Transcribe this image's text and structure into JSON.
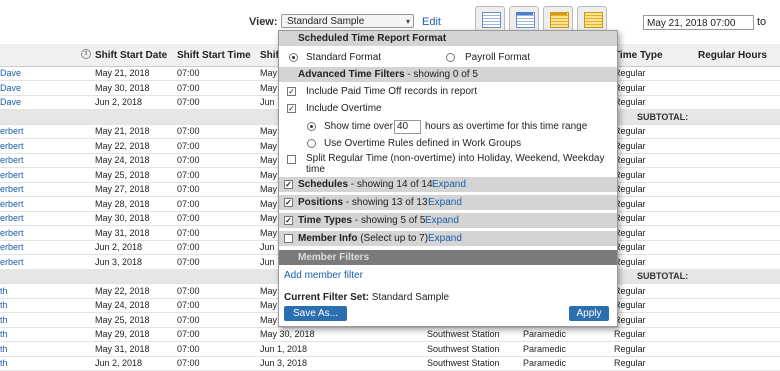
{
  "topbar": {
    "view_label": "View:",
    "view_value": "Standard Sample",
    "edit_label": "Edit",
    "date_value": "May 21, 2018 07:00",
    "to_label": "to",
    "view_icons": [
      "calendar-view-icon",
      "timeline-view-icon",
      "gold-calendar-view-icon",
      "gold-grid-view-icon"
    ]
  },
  "columns": {
    "start_date": "Shift Start Date",
    "start_time": "Shift Start Time",
    "shift_end_partial": "Shif",
    "time_type": "Time Type",
    "regular_hours": "Regular Hours"
  },
  "rows": [
    {
      "name": "Dave",
      "date": "May 21, 2018",
      "time": "07:00",
      "date2": "May",
      "type": "Regular"
    },
    {
      "name": "Dave",
      "date": "May 30, 2018",
      "time": "07:00",
      "date2": "May",
      "type": "Regular"
    },
    {
      "name": "Dave",
      "date": "Jun 2, 2018",
      "time": "07:00",
      "date2": "Jun",
      "type": "Regular"
    },
    {
      "subtotal": "SUBTOTAL:"
    },
    {
      "name": "erbert",
      "date": "May 21, 2018",
      "time": "07:00",
      "date2": "May",
      "type": "Regular"
    },
    {
      "name": "erbert",
      "date": "May 22, 2018",
      "time": "07:00",
      "date2": "May",
      "type": "Regular"
    },
    {
      "name": "erbert",
      "date": "May 24, 2018",
      "time": "07:00",
      "date2": "May",
      "type": "Regular"
    },
    {
      "name": "erbert",
      "date": "May 25, 2018",
      "time": "07:00",
      "date2": "May",
      "type": "Regular"
    },
    {
      "name": "erbert",
      "date": "May 27, 2018",
      "time": "07:00",
      "date2": "May",
      "type": "Regular"
    },
    {
      "name": "erbert",
      "date": "May 28, 2018",
      "time": "07:00",
      "date2": "May",
      "type": "Regular"
    },
    {
      "name": "erbert",
      "date": "May 30, 2018",
      "time": "07:00",
      "date2": "May",
      "type": "Regular"
    },
    {
      "name": "erbert",
      "date": "May 31, 2018",
      "time": "07:00",
      "date2": "May",
      "type": "Regular"
    },
    {
      "name": "erbert",
      "date": "Jun 2, 2018",
      "time": "07:00",
      "date2": "Jun",
      "type": "Regular"
    },
    {
      "name": "erbert",
      "date": "Jun 3, 2018",
      "time": "07:00",
      "date2": "Jun",
      "type": "Regular"
    },
    {
      "subtotal": "SUBTOTAL:"
    },
    {
      "name": "th",
      "date": "May 22, 2018",
      "time": "07:00",
      "date2": "May",
      "type": "Regular"
    },
    {
      "name": "th",
      "date": "May 24, 2018",
      "time": "07:00",
      "date2": "May",
      "type": "Regular"
    },
    {
      "name": "th",
      "date": "May 25, 2018",
      "time": "07:00",
      "date2": "May",
      "type": "Regular"
    },
    {
      "name": "th",
      "date": "May 29, 2018",
      "time": "07:00",
      "date2": "May 30, 2018",
      "loc": "Southwest Station",
      "role": "Paramedic",
      "type": "Regular"
    },
    {
      "name": "th",
      "date": "May 31, 2018",
      "time": "07:00",
      "date2": "Jun 1, 2018",
      "loc": "Southwest Station",
      "role": "Paramedic",
      "type": "Regular"
    },
    {
      "name": "th",
      "date": "Jun 2, 2018",
      "time": "07:00",
      "date2": "Jun 3, 2018",
      "loc": "Southwest Station",
      "role": "Paramedic",
      "type": "Regular"
    }
  ],
  "dialog": {
    "format_title": "Scheduled Time Report Format",
    "standard_format": "Standard Format",
    "payroll_format": "Payroll Format",
    "advanced_title": "Advanced Time Filters",
    "advanced_count": " - showing 0 of 5",
    "include_pto": "Include Paid Time Off records in report",
    "include_overtime": "Include Overtime",
    "show_time_over": "Show time over",
    "overtime_hours": "40",
    "hours_suffix": "hours as overtime for this time range",
    "use_rules": "Use Overtime Rules defined in Work Groups",
    "split_regular": "Split Regular Time (non-overtime) into Holiday, Weekend, Weekday",
    "split_regular_2": "time",
    "schedules_title": "Schedules",
    "schedules_count": " - showing 14 of 14",
    "positions_title": "Positions",
    "positions_count": " - showing 13 of 13",
    "time_types_title": "Time Types",
    "time_types_count": " - showing 5 of 5",
    "member_info_title": "Member Info",
    "member_info_hint": " (Select up to 7)",
    "expand": "Expand",
    "member_filters": "Member Filters",
    "add_member_filter": "Add member filter",
    "current_filter_label": "Current Filter Set:",
    "current_filter_value": " Standard Sample",
    "save_as": "Save As...",
    "apply": "Apply"
  }
}
